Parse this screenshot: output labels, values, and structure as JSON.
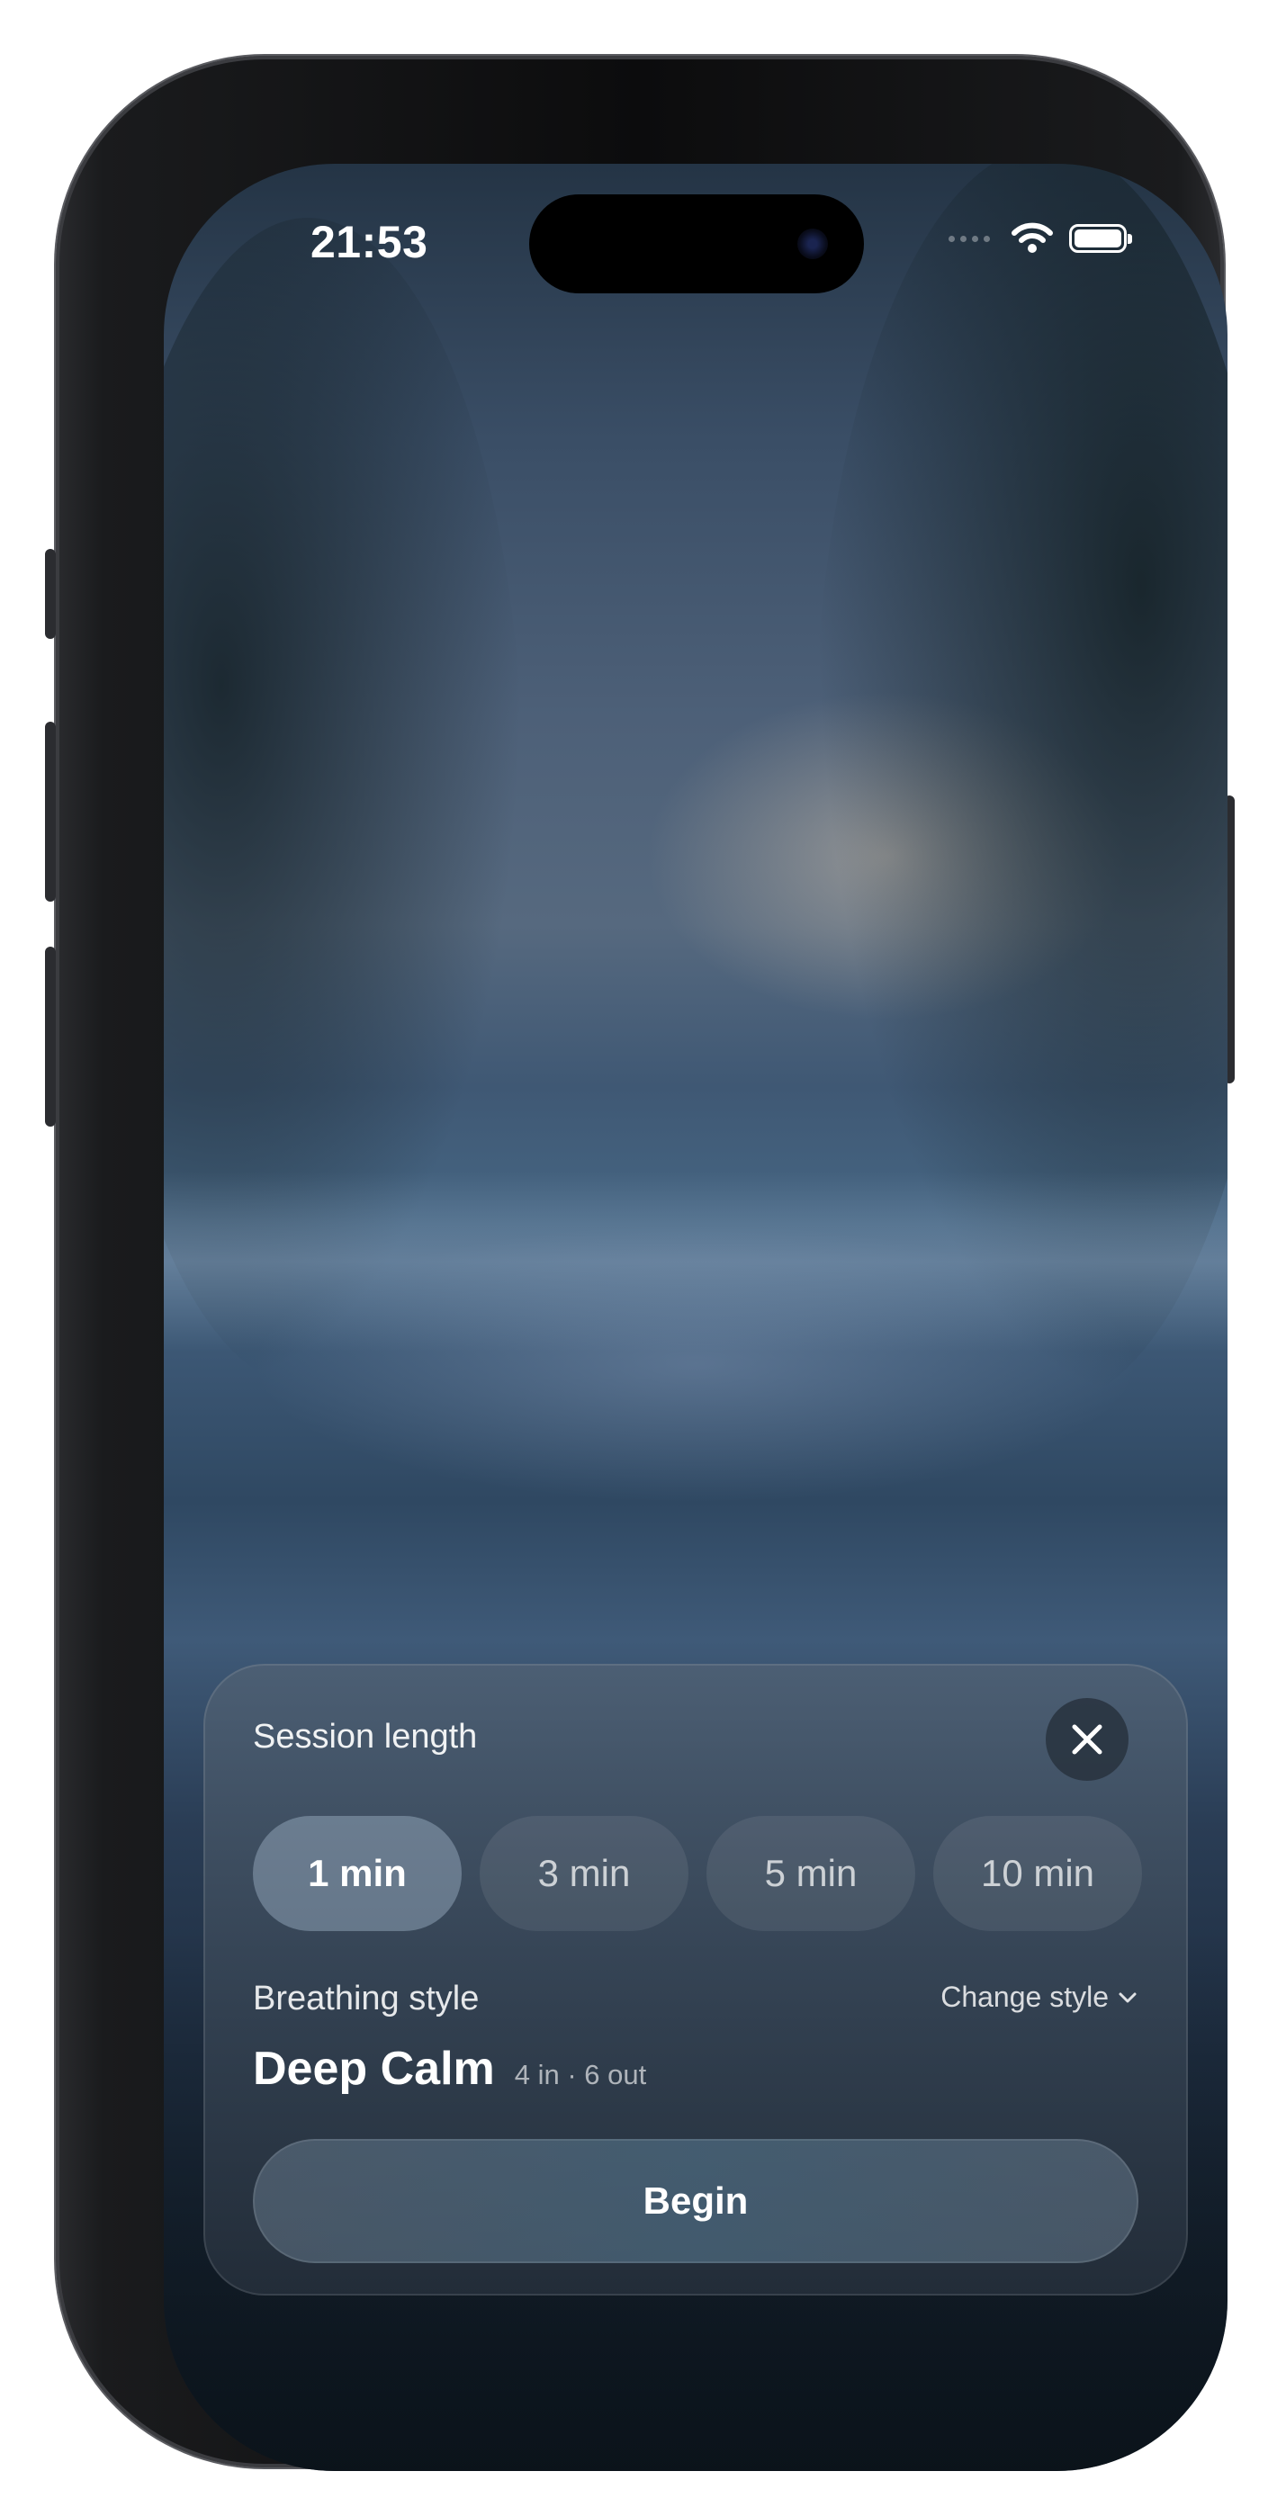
{
  "status_bar": {
    "time": "21:53",
    "wifi_icon": "wifi-icon",
    "battery_icon": "battery-icon"
  },
  "session_sheet": {
    "title": "Session length",
    "close_icon": "close-icon",
    "durations": [
      {
        "label": "1 min",
        "selected": true
      },
      {
        "label": "3 min",
        "selected": false
      },
      {
        "label": "5 min",
        "selected": false
      },
      {
        "label": "10 min",
        "selected": false
      }
    ],
    "breathing_style_label": "Breathing style",
    "change_style_label": "Change style",
    "change_style_icon": "chevron-down-icon",
    "style_name": "Deep Calm",
    "style_detail": "4 in · 6 out",
    "begin_label": "Begin"
  }
}
